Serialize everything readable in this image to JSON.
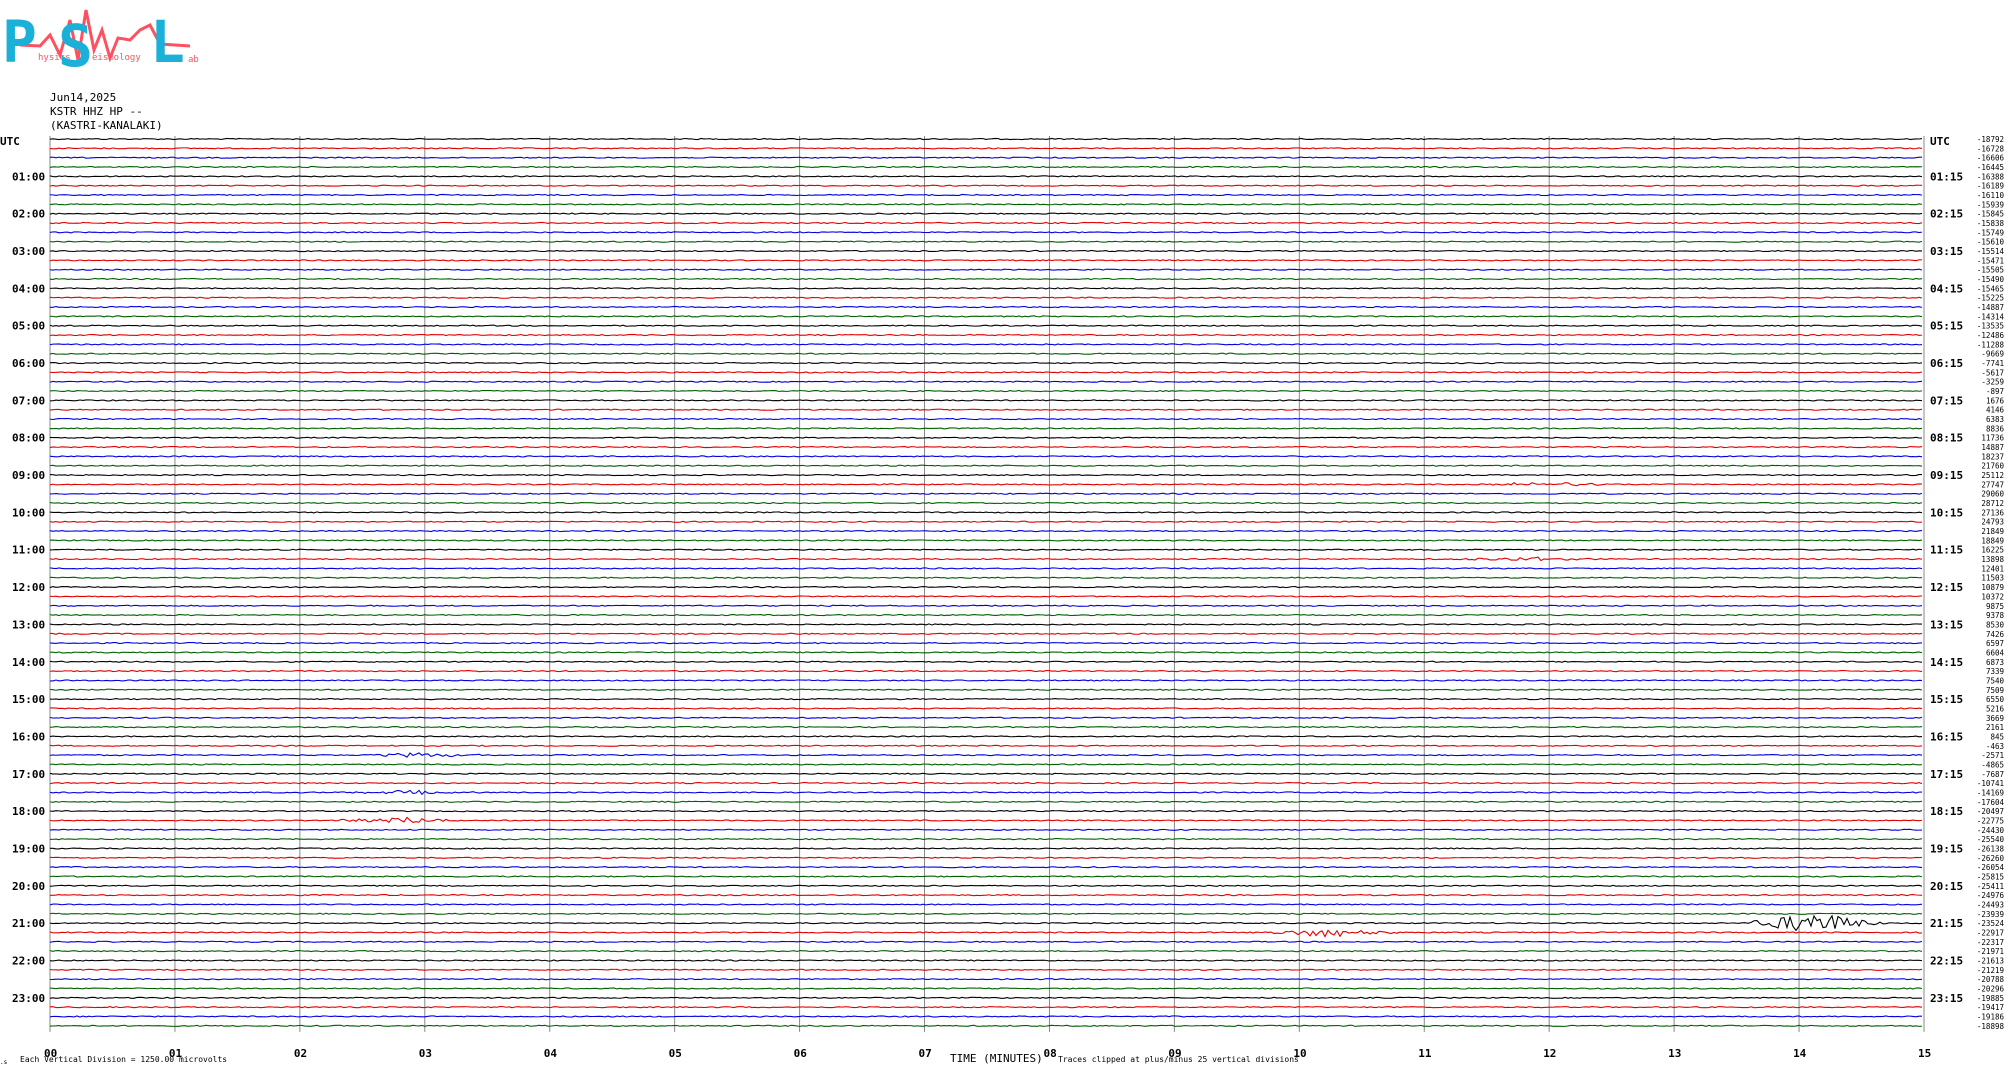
{
  "logo": {
    "letters": [
      "P",
      "S",
      "L"
    ],
    "small_words": [
      "hysics",
      "eismology",
      "ab"
    ]
  },
  "header": {
    "date": "Jun14,2025",
    "station": "KSTR HHZ HP --",
    "location": "(KASTRI-KANALAKI)"
  },
  "left_axis_label": "UTC",
  "right_axis_label": "UTC",
  "footer": {
    "left_note": "Each Vertical Division = 1250.00 microvolts",
    "x_title": "TIME (MINUTES)",
    "right_note": "Traces clipped at plus/minus 25 vertical divisions"
  },
  "colors": {
    "trace_cycle": [
      "#000000",
      "#e00000",
      "#0000e0",
      "#006000"
    ],
    "grid": "#888888",
    "logo_cyan": "#1ab0d8",
    "logo_red": "#ff5060"
  },
  "chart_data": {
    "type": "line",
    "x_range": [
      0,
      15
    ],
    "x_ticks": [
      "00",
      "01",
      "02",
      "03",
      "04",
      "05",
      "06",
      "07",
      "08",
      "09",
      "10",
      "11",
      "12",
      "13",
      "14",
      "15"
    ],
    "rows": 96,
    "left_hour_labels": [
      "01:00",
      "02:00",
      "03:00",
      "04:00",
      "05:00",
      "06:00",
      "07:00",
      "08:00",
      "09:00",
      "10:00",
      "11:00",
      "12:00",
      "13:00",
      "14:00",
      "15:00",
      "16:00",
      "17:00",
      "18:00",
      "19:00",
      "20:00",
      "21:00",
      "22:00",
      "23:00"
    ],
    "right_hour_labels": [
      "01:15",
      "02:15",
      "03:15",
      "04:15",
      "05:15",
      "06:15",
      "07:15",
      "08:15",
      "09:15",
      "10:15",
      "11:15",
      "12:15",
      "13:15",
      "14:15",
      "15:15",
      "16:15",
      "17:15",
      "18:15",
      "19:15",
      "20:15",
      "21:15",
      "22:15",
      "23:15"
    ],
    "trace_offsets": [
      "-18792",
      "-16728",
      "-16606",
      "-16445",
      "-16388",
      "-16189",
      "-16110",
      "-15939",
      "-15845",
      "-15838",
      "-15749",
      "-15610",
      "-15514",
      "-15471",
      "-15505",
      "-15490",
      "-15465",
      "-15225",
      "-14887",
      "-14314",
      "-13535",
      "-12486",
      "-11288",
      "-9669",
      "-7741",
      "-5617",
      "-3259",
      "-897",
      "1676",
      "4146",
      "6383",
      "8836",
      "11736",
      "14887",
      "18237",
      "21760",
      "25112",
      "27747",
      "29060",
      "28712",
      "27136",
      "24793",
      "21849",
      "18849",
      "16225",
      "13898",
      "12401",
      "11503",
      "10879",
      "10372",
      "9875",
      "9378",
      "8530",
      "7426",
      "6597",
      "6604",
      "6873",
      "7339",
      "7540",
      "7509",
      "6550",
      "5216",
      "3669",
      "2161",
      "845",
      "-463",
      "-2571",
      "-4865",
      "-7687",
      "-10741",
      "-14169",
      "-17604",
      "-20497",
      "-22775",
      "-24430",
      "-25540",
      "-26138",
      "-26260",
      "-26054",
      "-25815",
      "-25411",
      "-24976",
      "-24493",
      "-23939",
      "-23524",
      "-22917",
      "-22317",
      "-21971",
      "-21613",
      "-21219",
      "-20788",
      "-20296",
      "-19885",
      "-19417",
      "-19186",
      "-18898"
    ],
    "events": [
      {
        "row": 66,
        "minute": 2.95,
        "amplitude": 1.2
      },
      {
        "row": 70,
        "minute": 2.9,
        "amplitude": 1.0
      },
      {
        "row": 73,
        "minute": 2.8,
        "amplitude": 1.6
      },
      {
        "row": 85,
        "minute": 10.25,
        "amplitude": 2.4
      },
      {
        "row": 84,
        "minute": 14.12,
        "amplitude": 5.5
      },
      {
        "row": 37,
        "minute": 12.0,
        "amplitude": 1.2
      },
      {
        "row": 45,
        "minute": 11.8,
        "amplitude": 1.0
      }
    ]
  }
}
